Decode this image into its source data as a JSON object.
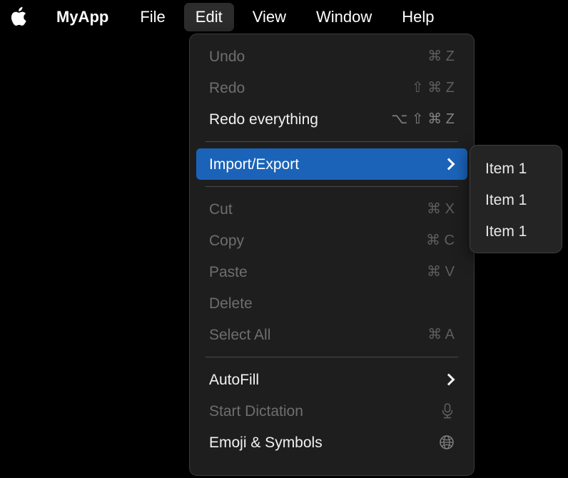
{
  "menubar": {
    "apple_icon": "apple-logo-icon",
    "items": [
      {
        "label": "MyApp",
        "bold": true,
        "active": false
      },
      {
        "label": "File",
        "bold": false,
        "active": false
      },
      {
        "label": "Edit",
        "bold": false,
        "active": true
      },
      {
        "label": "View",
        "bold": false,
        "active": false
      },
      {
        "label": "Window",
        "bold": false,
        "active": false
      },
      {
        "label": "Help",
        "bold": false,
        "active": false
      }
    ]
  },
  "colors": {
    "desktop_background": "#000000",
    "menu_background": "#1e1e1e",
    "submenu_background": "#242424",
    "highlight_blue": "#1b63b8",
    "enabled_text": "#f2f2f2",
    "disabled_text": "#6e6e6e",
    "shortcut_text": "#818181",
    "separator": "#4a4a4a",
    "menubar_active_tab": "#2c2c2c"
  },
  "edit_menu": {
    "groups": [
      {
        "rows": [
          {
            "label": "Undo",
            "shortcut": "⌘ Z",
            "state": "disabled",
            "trailing": "shortcut"
          },
          {
            "label": "Redo",
            "shortcut": "⇧ ⌘ Z",
            "state": "disabled",
            "trailing": "shortcut"
          },
          {
            "label": "Redo everything",
            "shortcut": "⌥ ⇧ ⌘ Z",
            "state": "enabled",
            "trailing": "shortcut"
          }
        ]
      },
      {
        "rows": [
          {
            "label": "Import/Export",
            "shortcut": "",
            "state": "highlighted",
            "trailing": "submenu-chevron"
          }
        ]
      },
      {
        "rows": [
          {
            "label": "Cut",
            "shortcut": "⌘ X",
            "state": "disabled",
            "trailing": "shortcut"
          },
          {
            "label": "Copy",
            "shortcut": "⌘ C",
            "state": "disabled",
            "trailing": "shortcut"
          },
          {
            "label": "Paste",
            "shortcut": "⌘ V",
            "state": "disabled",
            "trailing": "shortcut"
          },
          {
            "label": "Delete",
            "shortcut": "",
            "state": "disabled",
            "trailing": "none"
          },
          {
            "label": "Select All",
            "shortcut": "⌘ A",
            "state": "disabled",
            "trailing": "shortcut"
          }
        ]
      },
      {
        "rows": [
          {
            "label": "AutoFill",
            "shortcut": "",
            "state": "enabled",
            "trailing": "submenu-chevron"
          },
          {
            "label": "Start Dictation",
            "shortcut": "",
            "state": "disabled",
            "trailing": "microphone-icon"
          },
          {
            "label": "Emoji & Symbols",
            "shortcut": "",
            "state": "enabled",
            "trailing": "globe-icon"
          }
        ]
      }
    ]
  },
  "submenu": {
    "parent": "Import/Export",
    "items": [
      {
        "label": "Item 1"
      },
      {
        "label": "Item 1"
      },
      {
        "label": "Item 1"
      }
    ]
  }
}
